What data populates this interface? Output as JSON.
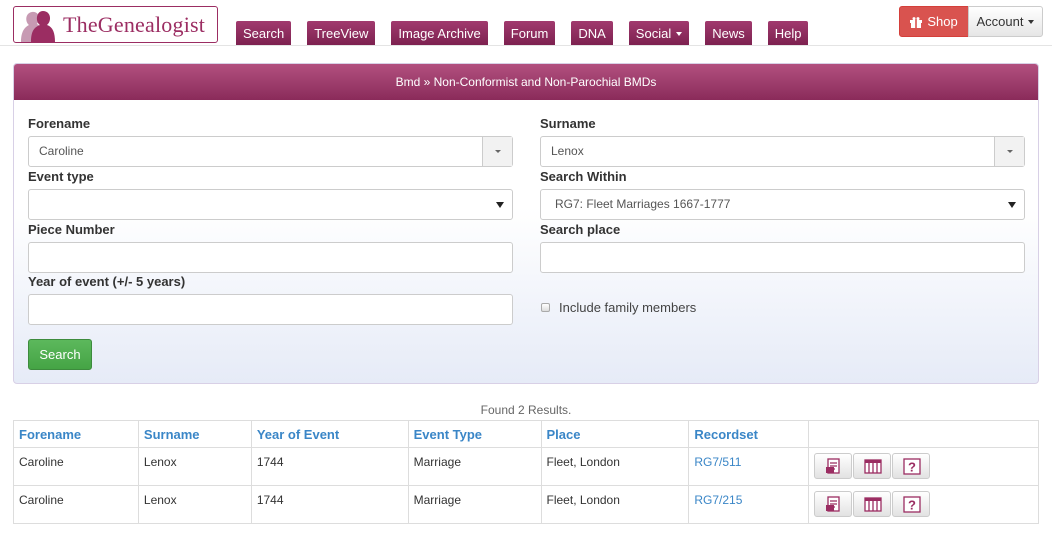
{
  "header": {
    "logo_text": "TheGenealogist",
    "nav": [
      {
        "label": "Search",
        "dropdown": false
      },
      {
        "label": "TreeView",
        "dropdown": false
      },
      {
        "label": "Image Archive",
        "dropdown": false
      },
      {
        "label": "Forum",
        "dropdown": false
      },
      {
        "label": "DNA",
        "dropdown": false
      },
      {
        "label": "Social",
        "dropdown": true
      },
      {
        "label": "News",
        "dropdown": false
      },
      {
        "label": "Help",
        "dropdown": false
      }
    ],
    "shop_label": "Shop",
    "account_label": "Account",
    "brand_color": "#8a2b5a",
    "shop_color": "#d9534f"
  },
  "panel": {
    "title": "Bmd » Non-Conformist and Non-Parochial BMDs",
    "forename": {
      "label": "Forename",
      "value": "Caroline"
    },
    "surname": {
      "label": "Surname",
      "value": "Lenox"
    },
    "event_type": {
      "label": "Event type",
      "value": ""
    },
    "search_within": {
      "label": "Search Within",
      "value": "RG7: Fleet Marriages 1667-1777"
    },
    "piece_number": {
      "label": "Piece Number",
      "value": ""
    },
    "search_place": {
      "label": "Search place",
      "value": ""
    },
    "year_of_event": {
      "label": "Year of event (+/- 5 years)",
      "value": ""
    },
    "include_family": {
      "label": "Include family members",
      "checked": false
    },
    "search_button": "Search",
    "search_color": "#5cb85c"
  },
  "results": {
    "summary": "Found 2 Results.",
    "columns": [
      "Forename",
      "Surname",
      "Year of Event",
      "Event Type",
      "Place",
      "Recordset"
    ],
    "rows": [
      {
        "forename": "Caroline",
        "surname": "Lenox",
        "year": "1744",
        "event_type": "Marriage",
        "place": "Fleet, London",
        "recordset": "RG7/511"
      },
      {
        "forename": "Caroline",
        "surname": "Lenox",
        "year": "1744",
        "event_type": "Marriage",
        "place": "Fleet, London",
        "recordset": "RG7/215"
      }
    ],
    "row_actions": [
      "transcript-icon",
      "image-icon",
      "help-icon"
    ],
    "link_color": "#3a86c7"
  }
}
